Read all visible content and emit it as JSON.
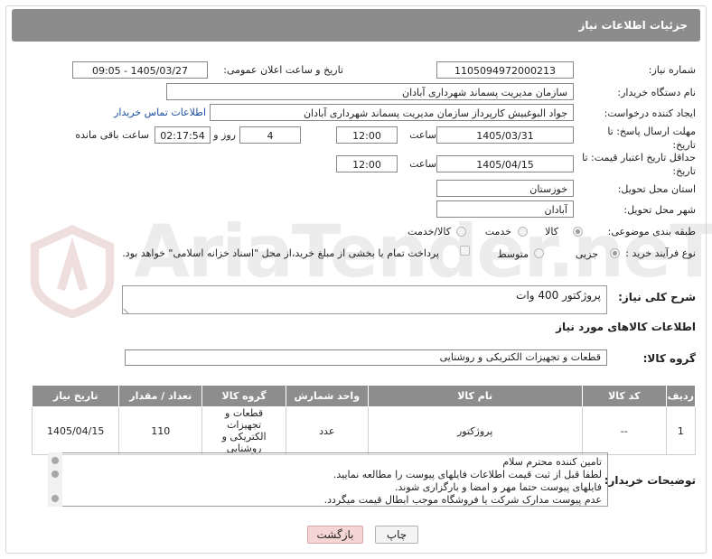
{
  "page": {
    "title": "جزئیات اطلاعات نیاز"
  },
  "fields": {
    "need_number_label": "شماره نیاز:",
    "need_number": "1105094972000213",
    "announce_label": "تاریخ و ساعت اعلان عمومی:",
    "announce_value": "1405/03/27 - 09:05",
    "buyer_org_label": "نام دستگاه خریدار:",
    "buyer_org": "سازمان مدیریت پسماند شهرداری آبادان",
    "creator_label": "ایجاد کننده درخواست:",
    "creator": "جواد البوغبیش کارپرداز سازمان مدیریت پسماند شهرداری آبادان",
    "contact_link": "اطلاعات تماس خریدار",
    "deadline_label": "مهلت ارسال پاسخ: تا تاریخ:",
    "deadline_date": "1405/03/31",
    "time_label": "ساعت",
    "deadline_time": "12:00",
    "days_value": "4",
    "days_label": "روز و",
    "remaining_time": "02:17:54",
    "remaining_label": "ساعت باقی مانده",
    "price_validity_label": "حداقل تاریخ اعتبار قیمت: تا تاریخ:",
    "price_validity_date": "1405/04/15",
    "price_validity_time": "12:00",
    "province_label": "استان محل تحویل:",
    "province": "خوزستان",
    "city_label": "شهر محل تحویل:",
    "city": "آبادان",
    "category_label": "طبقه بندی موضوعی:",
    "category_options": [
      "کالا",
      "خدمت",
      "کالا/خدمت"
    ],
    "process_label": "نوع فرآیند خرید :",
    "process_options": [
      "جزیی",
      "متوسط"
    ],
    "payment_note": "پرداخت تمام یا بخشی از مبلغ خرید،از محل \"اسناد خزانه اسلامی\" خواهد بود."
  },
  "description": {
    "label": "شرح کلی نیاز:",
    "value": "پروژکتور 400 وات"
  },
  "goods": {
    "section_title": "اطلاعات کالاهای مورد نیاز",
    "group_label": "گروه کالا:",
    "group_value": "قطعات و تجهیزات الکتریکی و روشنایی",
    "columns": [
      "ردیف",
      "کد کالا",
      "نام کالا",
      "واحد شمارش",
      "گروه کالا",
      "تعداد / مقدار",
      "تاریخ نیاز"
    ],
    "rows": [
      {
        "row": "1",
        "code": "--",
        "name": "پروژکتور",
        "unit": "عدد",
        "group": "قطعات و تجهیزات الکتریکی و روشنایی",
        "qty": "110",
        "date": "1405/04/15"
      }
    ]
  },
  "buyer_notes": {
    "label": "توضیحات خریدار:",
    "lines": [
      "تامین کننده محترم سلام",
      "لطفا قبل از ثبت قیمت اطلاعات فایلهای پیوست را مطالعه نمایید.",
      "فایلهای پیوست حتما مهر و امضا و بارگزاری شوند.",
      "عدم پیوست مدارک شرکت یا فروشگاه موجب ابطال قیمت میگردد."
    ]
  },
  "buttons": {
    "print": "چاپ",
    "back": "بازگشت"
  },
  "colors": {
    "header": "#8c8c8c",
    "link": "#1a4fa0",
    "back_button": "#f6d5d5"
  }
}
